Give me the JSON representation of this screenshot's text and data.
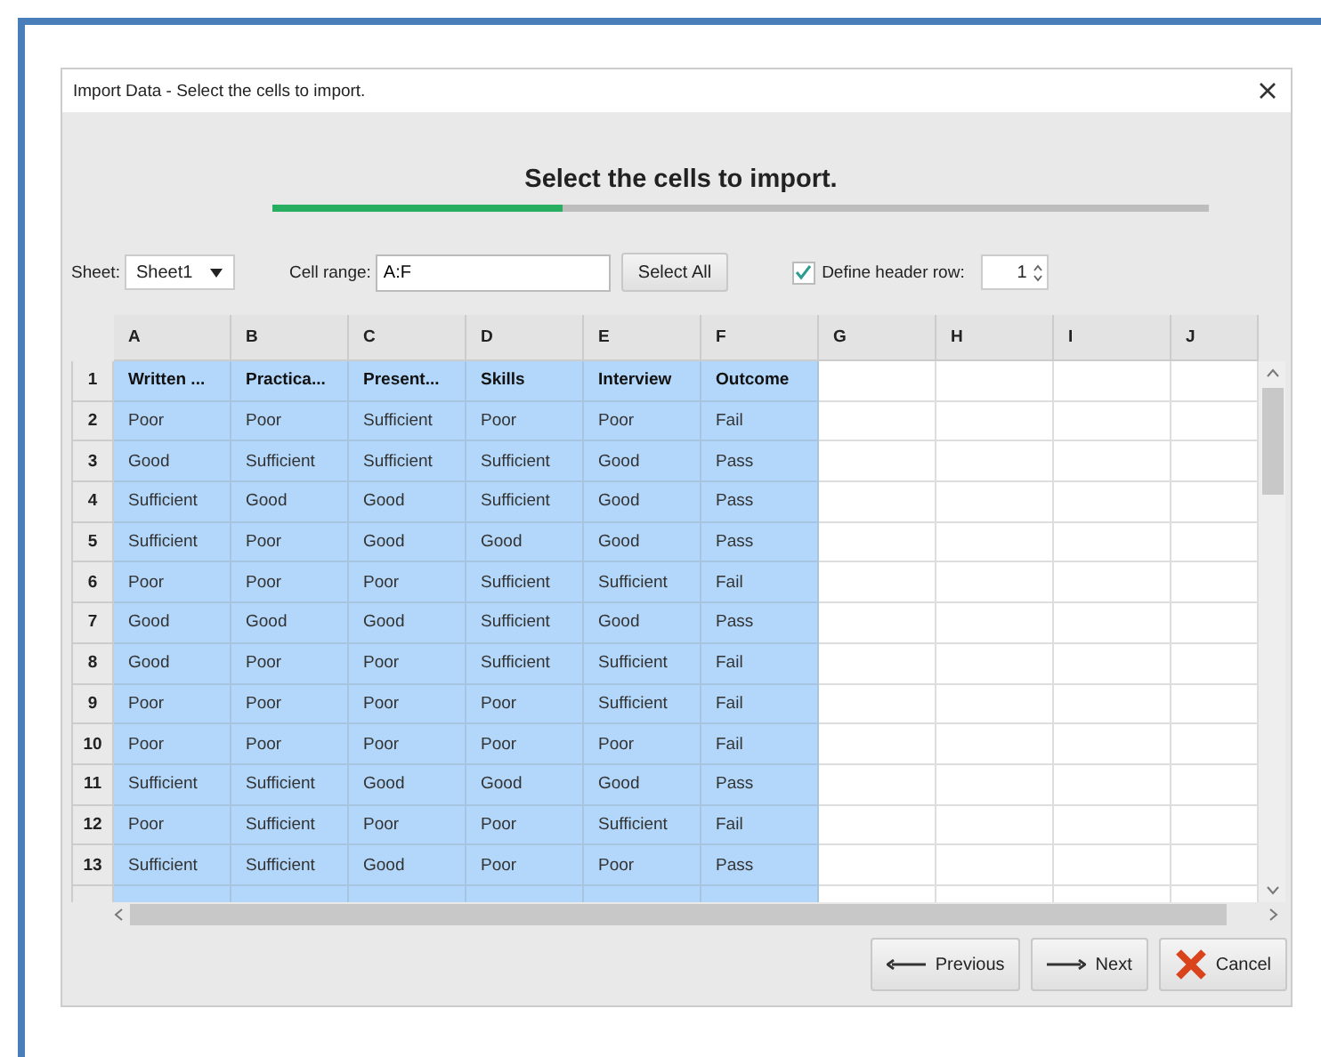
{
  "window": {
    "title": "Import Data - Select the cells to import."
  },
  "heading": "Select the cells to import.",
  "progress": {
    "level": 0.31
  },
  "sheet": {
    "label": "Sheet:",
    "value": "Sheet1"
  },
  "cell_range": {
    "label": "Cell range:",
    "value": "A:F"
  },
  "select_all_button": "Select All",
  "header_row": {
    "label": "Define header row:",
    "checked": true,
    "value": "1"
  },
  "table": {
    "columns": [
      {
        "label": "A",
        "selected": true
      },
      {
        "label": "B",
        "selected": true
      },
      {
        "label": "C",
        "selected": true
      },
      {
        "label": "D",
        "selected": true
      },
      {
        "label": "E",
        "selected": true
      },
      {
        "label": "F",
        "selected": true
      },
      {
        "label": "G",
        "selected": false
      },
      {
        "label": "H",
        "selected": false
      },
      {
        "label": "I",
        "selected": false
      },
      {
        "label": "J",
        "selected": false
      }
    ],
    "rows": [
      {
        "number": "1",
        "kind": "header",
        "cells": [
          "Written ...",
          "Practica...",
          "Present...",
          "Skills",
          "Interview",
          "Outcome"
        ]
      },
      {
        "number": "2",
        "kind": "data",
        "cells": [
          "Poor",
          "Poor",
          "Sufficient",
          "Poor",
          "Poor",
          "Fail"
        ]
      },
      {
        "number": "3",
        "kind": "data",
        "cells": [
          "Good",
          "Sufficient",
          "Sufficient",
          "Sufficient",
          "Good",
          "Pass"
        ]
      },
      {
        "number": "4",
        "kind": "data",
        "cells": [
          "Sufficient",
          "Good",
          "Good",
          "Sufficient",
          "Good",
          "Pass"
        ]
      },
      {
        "number": "5",
        "kind": "data",
        "cells": [
          "Sufficient",
          "Poor",
          "Good",
          "Good",
          "Good",
          "Pass"
        ]
      },
      {
        "number": "6",
        "kind": "data",
        "cells": [
          "Poor",
          "Poor",
          "Poor",
          "Sufficient",
          "Sufficient",
          "Fail"
        ]
      },
      {
        "number": "7",
        "kind": "data",
        "cells": [
          "Good",
          "Good",
          "Good",
          "Sufficient",
          "Good",
          "Pass"
        ]
      },
      {
        "number": "8",
        "kind": "data",
        "cells": [
          "Good",
          "Poor",
          "Poor",
          "Sufficient",
          "Sufficient",
          "Fail"
        ]
      },
      {
        "number": "9",
        "kind": "data",
        "cells": [
          "Poor",
          "Poor",
          "Poor",
          "Poor",
          "Sufficient",
          "Fail"
        ]
      },
      {
        "number": "10",
        "kind": "data",
        "cells": [
          "Poor",
          "Poor",
          "Poor",
          "Poor",
          "Poor",
          "Fail"
        ]
      },
      {
        "number": "11",
        "kind": "data",
        "cells": [
          "Sufficient",
          "Sufficient",
          "Good",
          "Good",
          "Good",
          "Pass"
        ]
      },
      {
        "number": "12",
        "kind": "data",
        "cells": [
          "Poor",
          "Sufficient",
          "Poor",
          "Poor",
          "Sufficient",
          "Fail"
        ]
      },
      {
        "number": "13",
        "kind": "data",
        "cells": [
          "Sufficient",
          "Sufficient",
          "Good",
          "Poor",
          "Poor",
          "Pass"
        ]
      }
    ]
  },
  "buttons": [
    {
      "label": "Previous",
      "kind": "previous"
    },
    {
      "label": "Next",
      "kind": "next"
    },
    {
      "label": "Cancel",
      "kind": "cancel"
    }
  ]
}
